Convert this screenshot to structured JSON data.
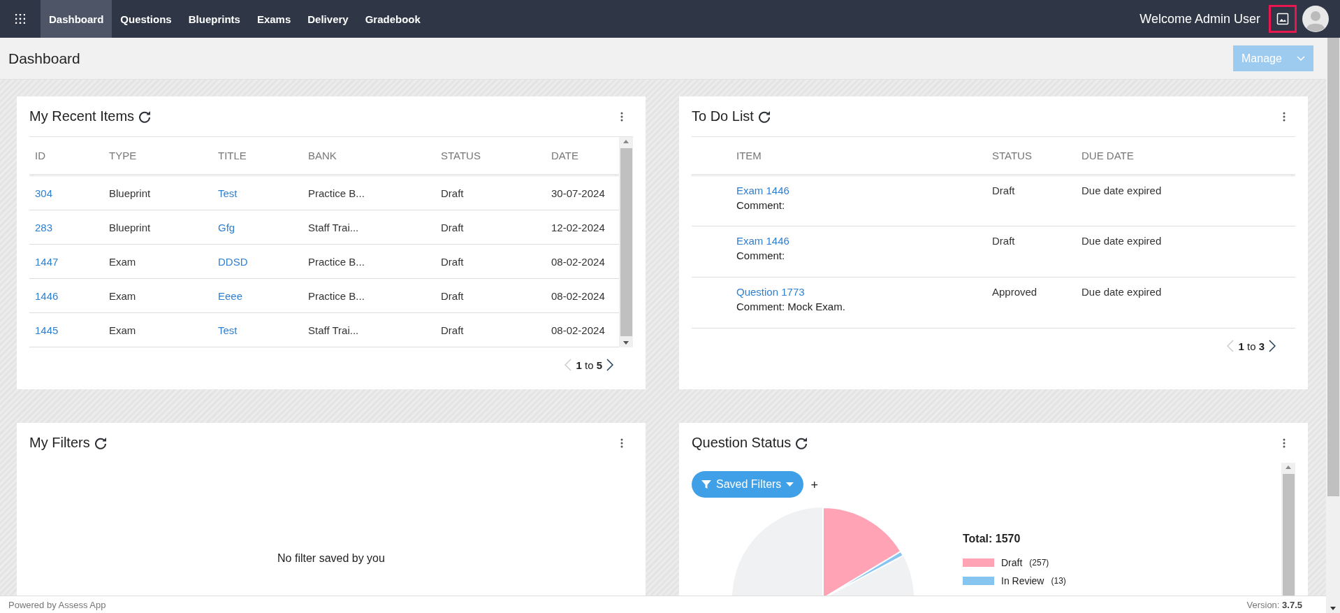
{
  "nav": {
    "items": [
      {
        "label": "Dashboard",
        "selected": true
      },
      {
        "label": "Questions",
        "selected": false
      },
      {
        "label": "Blueprints",
        "selected": false
      },
      {
        "label": "Exams",
        "selected": false
      },
      {
        "label": "Delivery",
        "selected": false
      },
      {
        "label": "Gradebook",
        "selected": false
      }
    ],
    "welcome": "Welcome Admin User"
  },
  "page": {
    "title": "Dashboard",
    "manage_button": "Manage"
  },
  "recent_items": {
    "title": "My Recent Items",
    "columns": [
      "ID",
      "TYPE",
      "TITLE",
      "BANK",
      "STATUS",
      "DATE"
    ],
    "rows": [
      {
        "id": "304",
        "type": "Blueprint",
        "title": "Test",
        "bank": "Practice B...",
        "status": "Draft",
        "date": "30-07-2024"
      },
      {
        "id": "283",
        "type": "Blueprint",
        "title": "Gfg",
        "bank": "Staff Trai...",
        "status": "Draft",
        "date": "12-02-2024"
      },
      {
        "id": "1447",
        "type": "Exam",
        "title": "DDSD",
        "bank": "Practice B...",
        "status": "Draft",
        "date": "08-02-2024"
      },
      {
        "id": "1446",
        "type": "Exam",
        "title": "Eeee",
        "bank": "Practice B...",
        "status": "Draft",
        "date": "08-02-2024"
      },
      {
        "id": "1445",
        "type": "Exam",
        "title": "Test",
        "bank": "Staff Trai...",
        "status": "Draft",
        "date": "08-02-2024"
      }
    ],
    "pager": "**1** to **5**"
  },
  "todo": {
    "title": "To Do List",
    "columns": [
      "ITEM",
      "STATUS",
      "DUE DATE"
    ],
    "rows": [
      {
        "item": "Exam 1446",
        "comment": "Comment:",
        "status": "Draft",
        "due": "Due date expired"
      },
      {
        "item": "Exam 1446",
        "comment": "Comment:",
        "status": "Draft",
        "due": "Due date expired"
      },
      {
        "item": "Question 1773",
        "comment": "Comment: Mock Exam.",
        "status": "Approved",
        "due": "Due date expired"
      }
    ],
    "pager": "**1** to **3**"
  },
  "filters": {
    "title": "My Filters",
    "empty_message": "No filter saved by you"
  },
  "question_status": {
    "title": "Question Status",
    "saved_filters": "Saved Filters",
    "add": "+",
    "total": "Total: 1570",
    "legend": [
      {
        "label": "Draft",
        "count": "(257)",
        "color": "#ffa3b5"
      },
      {
        "label": "In Review",
        "count": "(13)",
        "color": "#86c5f0"
      }
    ]
  },
  "footer": {
    "left": "Powered by Assess App",
    "version": "Version: **3.7.5**"
  }
}
